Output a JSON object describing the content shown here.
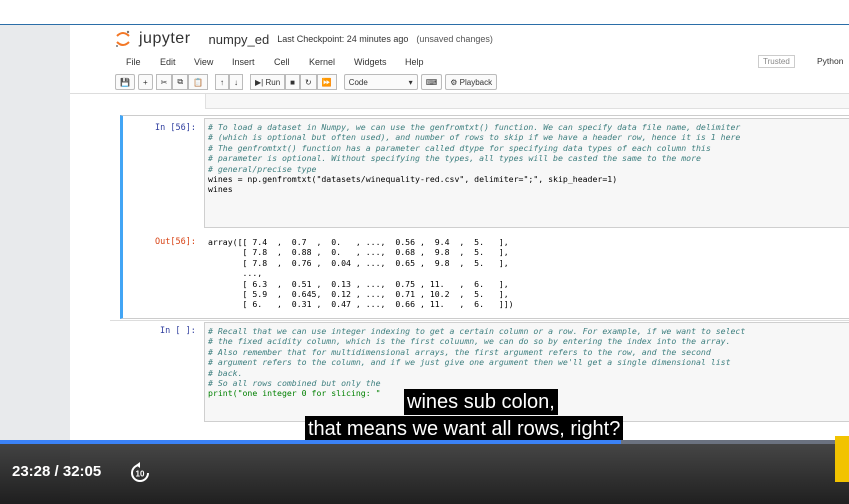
{
  "jupyter": {
    "brand": "jupyter",
    "notebook_name": "numpy_ed",
    "checkpoint": "Last Checkpoint: 24 minutes ago",
    "unsaved": "(unsaved changes)",
    "menu": [
      "File",
      "Edit",
      "View",
      "Insert",
      "Cell",
      "Kernel",
      "Widgets",
      "Help"
    ],
    "trusted": "Trusted",
    "kernel": "Python",
    "toolbar": {
      "run": "Run",
      "cell_type": "Code",
      "playback": "Playback"
    }
  },
  "cells": {
    "in56_prompt": "In [56]:",
    "in56_code": [
      "# To load a dataset in Numpy, we can use the genfromtxt() function. We can specify data file name, delimiter",
      "# (which is optional but often used), and number of rows to skip if we have a header row, hence it is 1 here",
      "",
      "# The genfromtxt() function has a parameter called dtype for specifying data types of each column this",
      "# parameter is optional. Without specifying the types, all types will be casted the same to the more",
      "# general/precise type",
      "",
      "wines = np.genfromtxt(\"datasets/winequality-red.csv\", delimiter=\";\", skip_header=1)",
      "wines"
    ],
    "out56_prompt": "Out[56]:",
    "out56_text": [
      "array([[ 7.4  ,  0.7  ,  0.   , ...,  0.56 ,  9.4  ,  5.   ],",
      "       [ 7.8  ,  0.88 ,  0.   , ...,  0.68 ,  9.8  ,  5.   ],",
      "       [ 7.8  ,  0.76 ,  0.04 , ...,  0.65 ,  9.8  ,  5.   ],",
      "       ...,",
      "       [ 6.3  ,  0.51 ,  0.13 , ...,  0.75 , 11.   ,  6.   ],",
      "       [ 5.9  ,  0.645,  0.12 , ...,  0.71 , 10.2  ,  5.   ],",
      "       [ 6.   ,  0.31 ,  0.47 , ...,  0.66 , 11.   ,  6.   ]])"
    ],
    "in_next_prompt": "In [ ]:",
    "in_next_code": [
      "# Recall that we can use integer indexing to get a certain column or a row. For example, if we want to select",
      "# the fixed acidity column, which is the first coluumn, we can do so by entering the index into the array.",
      "# Also remember that for multidimensional arrays, the first argument refers to the row, and the second",
      "# argument refers to the column, and if we just give one argument then we'll get a single dimensional list",
      "# back.",
      "",
      "# So all rows combined but only the",
      "print(\"one integer 0 for slicing: \""
    ]
  },
  "captions": {
    "line1": "wines sub colon,",
    "line2": "that means we want all rows, right?"
  },
  "player": {
    "time": "23:28 / 32:05",
    "replay_seconds": "10",
    "progress_fraction": 0.731
  }
}
